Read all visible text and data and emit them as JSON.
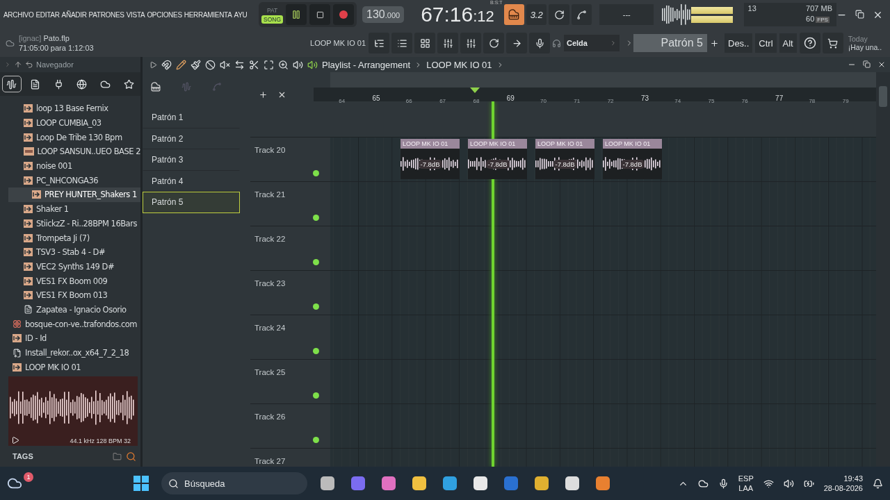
{
  "menu": [
    "ARCHIVO",
    "EDITAR",
    "AÑADIR",
    "PATRONES",
    "VISTA",
    "OPCIONES",
    "HERRAMIENTA",
    "AYU"
  ],
  "transport": {
    "modes": [
      {
        "label": "PAT",
        "selected": false
      },
      {
        "label": "SONG",
        "selected": true
      }
    ],
    "playing": true,
    "tempo": "130",
    "tempo_decimals": ".000",
    "time_main": "67:16",
    "time_ticks": ":12",
    "time_format": "B:S:T",
    "step_label": "3.2",
    "display": "---"
  },
  "monitor": {
    "cpu": "13",
    "ram": "707 MB",
    "fps": "60",
    "fps_label": "FPS"
  },
  "project": {
    "user": "[ignac]",
    "file": "Pato.flp",
    "range": "71:05:00 para 1:12:03",
    "hint": "LOOP MK IO 01"
  },
  "toolbar": {
    "snap": "Celda",
    "pattern": "Patrón 5",
    "keys": [
      "Des..",
      "Ctrl",
      "Alt"
    ],
    "news_title": "Today",
    "news_text": "¡Hay una.."
  },
  "browser": {
    "title": "Navegador",
    "tabs": [
      {
        "selected": true
      },
      {
        "selected": false
      },
      {
        "selected": false
      },
      {
        "selected": false
      },
      {
        "selected": false
      },
      {
        "selected": false
      }
    ],
    "tree": [
      {
        "children": [
          {
            "name": "loop 13 Base Fernix",
            "kind": "loop",
            "selected": false
          },
          {
            "name": "LOOP CUMBIA_03",
            "kind": "loop",
            "selected": false
          },
          {
            "name": "Loop De Tribe 130 Bpm",
            "kind": "loop",
            "selected": false
          },
          {
            "name": "LOOP SANSUN..UEO BASE 2",
            "kind": "mp3",
            "selected": false
          },
          {
            "name": "noise 001",
            "kind": "loop",
            "selected": false
          },
          {
            "name": "PC_NHCONGA36",
            "kind": "loop",
            "selected": false
          },
          {
            "name": "PREY HUNTER_Shakers 1",
            "kind": "loop",
            "selected": true
          },
          {
            "name": "Shaker 1",
            "kind": "loop",
            "selected": false
          },
          {
            "name": "StiickzZ - Ri..28BPM 16Bars",
            "kind": "loop",
            "selected": false
          },
          {
            "name": "Trompeta Ji  (7)",
            "kind": "loop",
            "selected": false
          },
          {
            "name": "TSV3 - Stab 4 - D#",
            "kind": "loop",
            "selected": false
          },
          {
            "name": "VEC2 Synths 149 D#",
            "kind": "loop",
            "selected": false
          },
          {
            "name": "VES1 FX Boom 009",
            "kind": "loop",
            "selected": false
          },
          {
            "name": "VES1 FX Boom 013",
            "kind": "loop",
            "selected": false
          },
          {
            "name": "Zapatea - Ignacio Osorio",
            "kind": "file",
            "selected": false
          }
        ]
      },
      {
        "name": "bosque-con-ve..trafondos.com",
        "kind": "image",
        "selected": false
      },
      {
        "name": "ID - Id",
        "kind": "loop",
        "selected": false
      },
      {
        "name": "Install_rekor..ox_x64_7_2_18",
        "kind": "zip",
        "selected": false
      },
      {
        "name": "LOOP MK IO 01",
        "kind": "loop",
        "selected": false
      }
    ],
    "preview_info": "44.1 kHz 128 BPM 32",
    "tags": "TAGS"
  },
  "playlist": {
    "title": "Playlist - Arrangement",
    "breadcrumb": "LOOP MK IO 01",
    "patterns": [
      {
        "name": "Patrón 1",
        "selected": false
      },
      {
        "name": "Patrón 2",
        "selected": false
      },
      {
        "name": "Patrón 3",
        "selected": false
      },
      {
        "name": "Patrón 4",
        "selected": false
      },
      {
        "name": "Patrón 5",
        "selected": true
      }
    ],
    "ruler": [
      {
        "label": "64",
        "major": false
      },
      {
        "label": "65",
        "major": true
      },
      {
        "label": "66",
        "major": false
      },
      {
        "label": "67",
        "major": false
      },
      {
        "label": "68",
        "major": false
      },
      {
        "label": "69",
        "major": true
      },
      {
        "label": "70",
        "major": false
      },
      {
        "label": "71",
        "major": false
      },
      {
        "label": "72",
        "major": false
      },
      {
        "label": "73",
        "major": true
      },
      {
        "label": "74",
        "major": false
      },
      {
        "label": "75",
        "major": false
      },
      {
        "label": "76",
        "major": false
      },
      {
        "label": "77",
        "major": true
      },
      {
        "label": "78",
        "major": false
      },
      {
        "label": "79",
        "major": false
      }
    ],
    "tracks": [
      {
        "name": "Track 20",
        "clips": [
          {
            "name": "LOOP MK IO 01",
            "gain": "-7.8dB"
          },
          {
            "name": "LOOP MK IO 01",
            "gain": "-7.8dB"
          },
          {
            "name": "LOOP MK IO 01",
            "gain": "-7.8dB"
          },
          {
            "name": "LOOP MK IO 01",
            "gain": "-7.8dB"
          }
        ]
      },
      {
        "name": "Track 21"
      },
      {
        "name": "Track 22"
      },
      {
        "name": "Track 23"
      },
      {
        "name": "Track 24"
      },
      {
        "name": "Track 25"
      },
      {
        "name": "Track 26"
      },
      {
        "name": "Track 27"
      }
    ]
  },
  "taskbar": {
    "weather_badge": "1",
    "search": "Búsqueda",
    "lang": "ESP",
    "region": "LAA",
    "time": "19:43",
    "date": "28-08-2026"
  }
}
